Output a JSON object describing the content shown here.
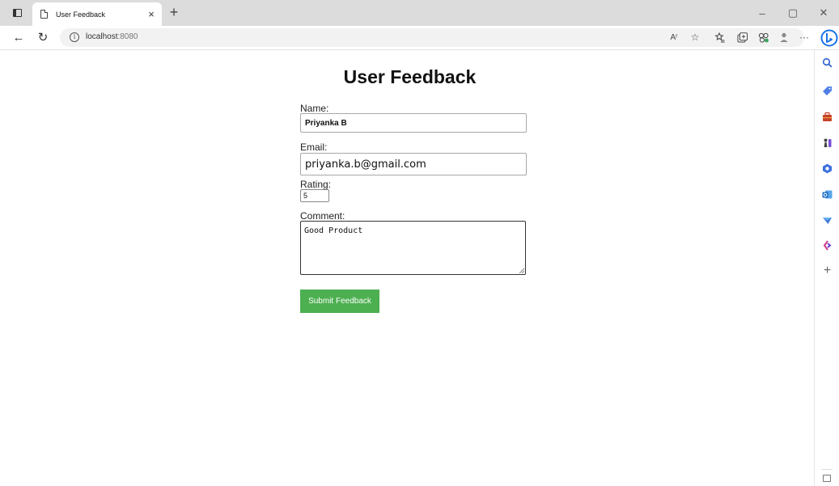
{
  "browser": {
    "tab_title": "User Feedback",
    "tab_close": "×",
    "new_tab": "+",
    "url_host": "localhost",
    "url_port": ":8080",
    "window_controls": {
      "minimize": "–",
      "restore": "▢",
      "close": "✕"
    },
    "toolbar_icons": [
      "read-aloud-icon",
      "favorite-star-icon",
      "favorites-list-icon",
      "collections-icon",
      "extensions-icon",
      "profile-icon",
      "more-icon"
    ],
    "read_aloud_label": "Aʳ",
    "more_label": "···"
  },
  "sidebar": {
    "icons": [
      "search-icon",
      "tag-icon",
      "briefcase-icon",
      "chess-icon",
      "office-icon",
      "outlook-icon",
      "send-icon",
      "designer-icon"
    ],
    "add_label": "+"
  },
  "page": {
    "title": "User Feedback",
    "form": {
      "name_label": "Name:",
      "name_value": "Priyanka B",
      "email_label": "Email:",
      "email_value": "priyanka.b@gmail.com",
      "rating_label": "Rating:",
      "rating_value": "5",
      "comment_label": "Comment:",
      "comment_value": "Good Product",
      "submit_label": "Submit Feedback"
    }
  },
  "colors": {
    "submit_button": "#4caf50",
    "tab_strip": "#dcdcdc",
    "bing_blue": "#1a73e8"
  }
}
